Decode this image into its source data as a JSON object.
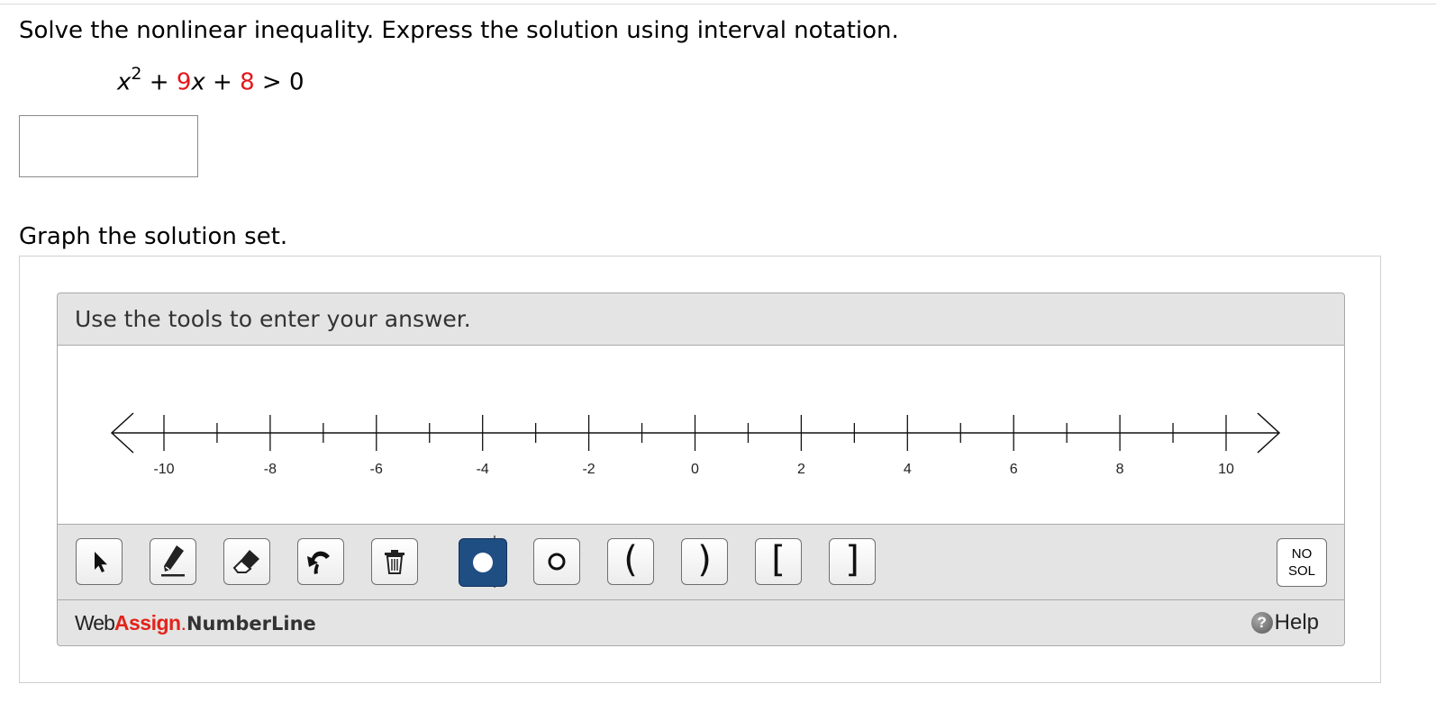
{
  "question": {
    "prompt": "Solve the nonlinear inequality. Express the solution using interval notation.",
    "equation": {
      "var": "x",
      "exponent": "2",
      "plus1": " + ",
      "coef": "9",
      "var2": "x",
      "plus2": " + ",
      "constant": "8",
      "relation": " > 0"
    },
    "answer_value": ""
  },
  "graph": {
    "label": "Graph the solution set.",
    "instruction": "Use the tools to enter your answer.",
    "numberline": {
      "min": -10,
      "max": 10,
      "minor_step": 1,
      "labels": [
        "-10",
        "-8",
        "-6",
        "-4",
        "-2",
        "0",
        "2",
        "4",
        "6",
        "8",
        "10"
      ]
    },
    "tools": [
      {
        "name": "pointer-icon",
        "active": false
      },
      {
        "name": "pencil-icon",
        "active": false
      },
      {
        "name": "eraser-icon",
        "active": false
      },
      {
        "name": "undo-icon",
        "active": false
      },
      {
        "name": "trash-icon",
        "active": false
      },
      {
        "name": "closed-point-icon",
        "active": true
      },
      {
        "name": "open-point-icon",
        "active": false
      },
      {
        "name": "open-left-paren-icon",
        "glyph": "(",
        "active": false
      },
      {
        "name": "open-right-paren-icon",
        "glyph": ")",
        "active": false
      },
      {
        "name": "closed-left-bracket-icon",
        "glyph": "[",
        "active": false
      },
      {
        "name": "closed-right-bracket-icon",
        "glyph": "]",
        "active": false
      }
    ],
    "no_solution": {
      "line1": "NO",
      "line2": "SOL"
    }
  },
  "footer": {
    "brand_web": "Web",
    "brand_assign": "Assign",
    "brand_dot": ".",
    "brand_product": "NumberLine",
    "help_label": "Help",
    "help_icon_glyph": "?"
  },
  "colors": {
    "highlight": "#e4161b",
    "active_tool": "#1f4e83",
    "panel_bg": "#e4e4e4"
  }
}
